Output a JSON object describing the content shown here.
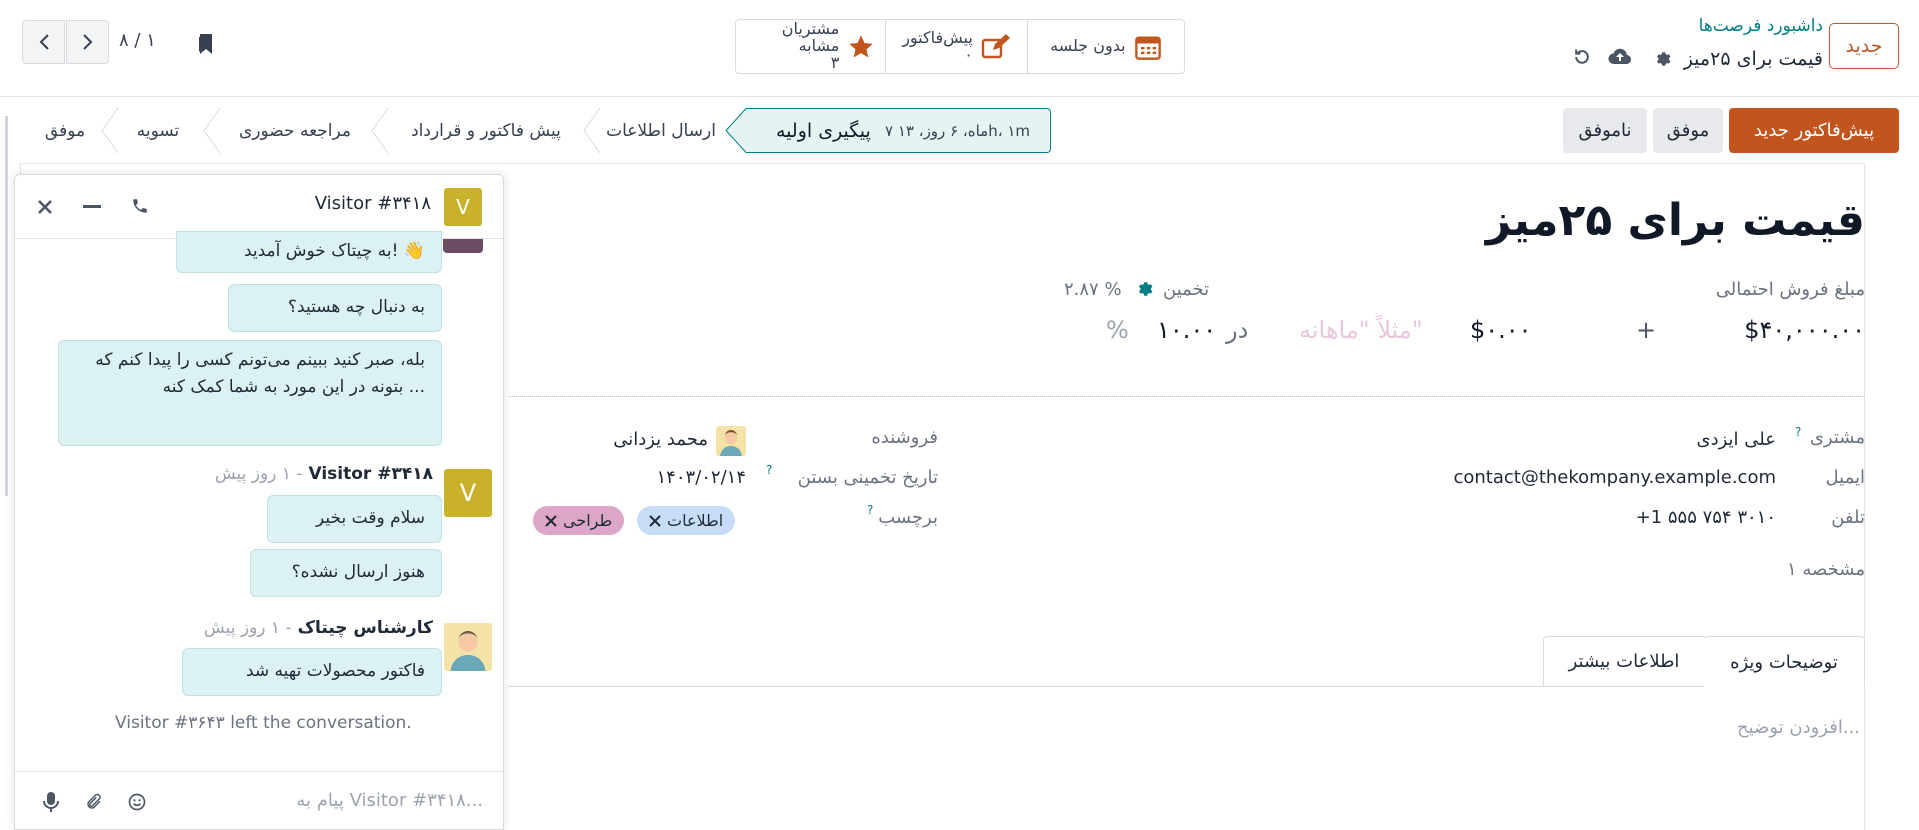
{
  "header": {
    "new_button": "جدید",
    "breadcrumb_parent": "داشبورد فرصت‌ها",
    "record_title": "قیمت برای ۲۵میز",
    "smart_buttons": [
      {
        "label": "بدون جلسه",
        "sub": "",
        "icon": "calendar-icon"
      },
      {
        "label": "پیش‌فاکتور",
        "sub": "۰",
        "icon": "edit-icon"
      },
      {
        "label": "مشتریان مشابه",
        "sub": "۳",
        "icon": "star-icon"
      }
    ],
    "pager": "۸ / ۱"
  },
  "statusbar": {
    "new_quote": "پیش‌فاکتور جدید",
    "won": "موفق",
    "lost": "ناموفق",
    "stages": [
      "پیگیری اولیه",
      "ارسال اطلاعات",
      "پیش فاکتور و قرارداد",
      "مراجعه حضوری",
      "تسویه",
      "موفق"
    ],
    "active_duration": "۷ ماه، ۶ روز، ۱۳h، ۱m"
  },
  "form": {
    "title": "قیمت برای ۲۵میز",
    "expected_revenue_label": "مبلغ فروش احتمالی",
    "probability_label": "تخمین",
    "probability_value": "۲.۸۷ %",
    "revenue": "$۴۰,۰۰۰.۰۰",
    "plus": "+",
    "recurring": "$۰.۰۰",
    "recurring_placeholder": "مثلاً \"ماهانه\"",
    "at_word": "در",
    "probability_input": "۱۰.۰۰",
    "percent": "%",
    "customer_label": "مشتری",
    "customer_value": "علی ایزدی",
    "email_label": "ایمیل",
    "email_value": "contact@thekompany.example.com",
    "phone_label": "تلفن",
    "phone_value": "+1 ۵۵۵ ۷۵۴ ۳۰۱۰",
    "property_label": "مشخصه ۱",
    "salesperson_label": "فروشنده",
    "salesperson_value": "محمد یزدانی",
    "deadline_label": "تاریخ تخمینی بستن",
    "deadline_value": "۱۴۰۳/۰۲/۱۴",
    "tags_label": "برچسب",
    "tags": [
      "اطلاعات",
      "طراحی"
    ],
    "help_mark": "?",
    "tabs": [
      "توضیحات ویژه",
      "اطلاعات بیشتر"
    ],
    "notes_placeholder": "افزودن توضیح..."
  },
  "chat": {
    "title": "Visitor #۳۴۱۸",
    "avatar_letter": "V",
    "messages_top": [
      "به چیتاک خوش آمدید! 👋",
      "به دنبال چه هستید؟",
      "بله، صبر کنید ببینم می‌تونم کسی را پیدا کنم که بتونه در این مورد به شما کمک کنه ..."
    ],
    "visitor_author": "Visitor #۳۴۱۸",
    "visitor_time": "- ۱ روز پیش",
    "visitor_messages": [
      "سلام وقت بخیر",
      "هنوز ارسال نشده؟"
    ],
    "agent_author": "کارشناس چیتاک",
    "agent_time": "- ۱ روز پیش",
    "agent_messages": [
      "فاکتور محصولات تهیه شد"
    ],
    "system_note": "Visitor #۳۶۴۳ left the conversation.",
    "input_placeholder": "پیام به Visitor #۳۴۱۸..."
  },
  "colors": {
    "primary": "#c2551d",
    "accent": "#017e84",
    "chat_bubble": "#dcf1f2"
  }
}
